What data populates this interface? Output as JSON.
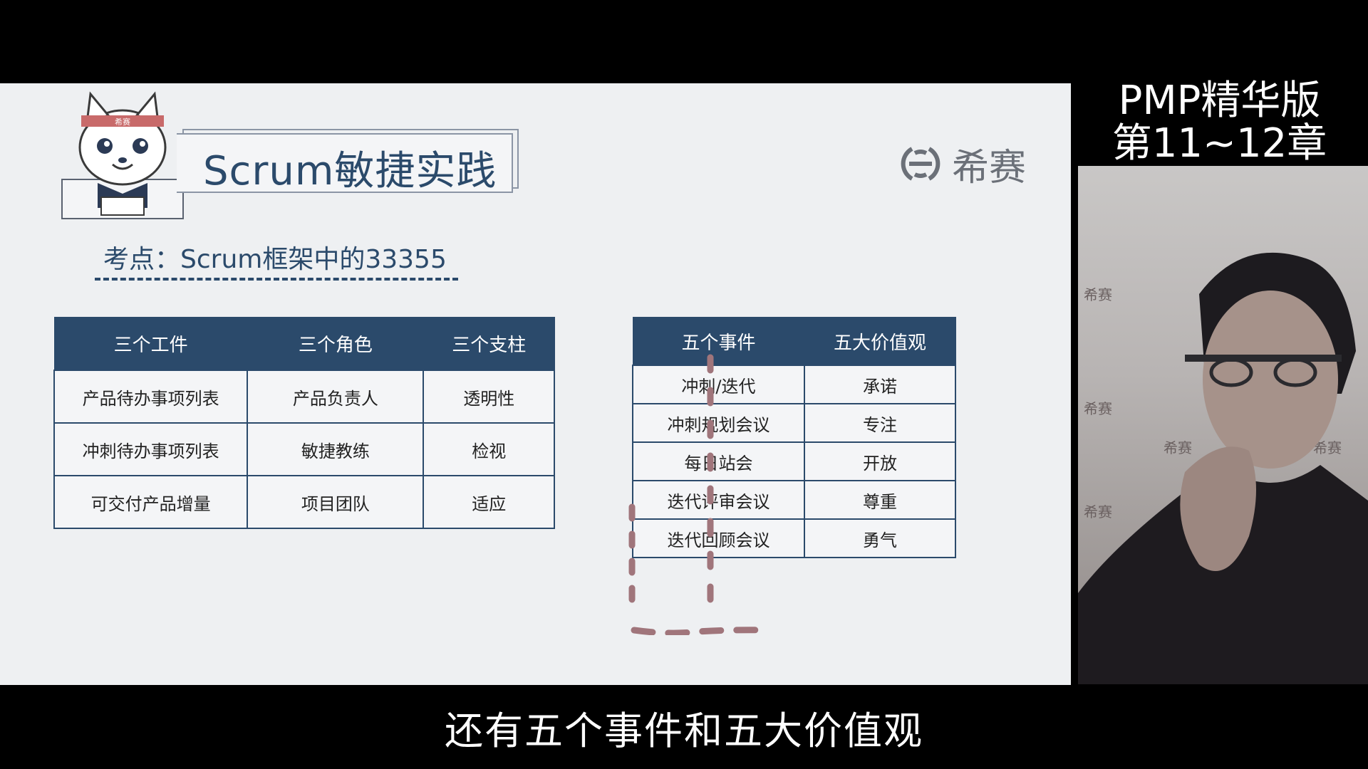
{
  "slide": {
    "title": "Scrum敏捷实践",
    "brand_name": "希赛",
    "mascot_headband": "希赛",
    "exam_point": "考点：Scrum框架中的33355"
  },
  "table_left": {
    "headers": [
      "三个工件",
      "三个角色",
      "三个支柱"
    ],
    "rows": [
      [
        "产品待办事项列表",
        "产品负责人",
        "透明性"
      ],
      [
        "冲刺待办事项列表",
        "敏捷教练",
        "检视"
      ],
      [
        "可交付产品增量",
        "项目团队",
        "适应"
      ]
    ]
  },
  "table_right": {
    "headers": [
      "五个事件",
      "五大价值观"
    ],
    "rows": [
      [
        "冲刺/迭代",
        "承诺"
      ],
      [
        "冲刺规划会议",
        "专注"
      ],
      [
        "每日站会",
        "开放"
      ],
      [
        "迭代评审会议",
        "尊重"
      ],
      [
        "迭代回顾会议",
        "勇气"
      ]
    ]
  },
  "annotation_color": "#a0757b",
  "right_panel": {
    "course_title_line1": "PMP精华版",
    "course_title_line2": "第11~12章",
    "watermark": "希赛"
  },
  "subtitle": "还有五个事件和五大价值观",
  "colors": {
    "navy": "#2b4a6b",
    "slide_bg": "#eef0f2"
  }
}
